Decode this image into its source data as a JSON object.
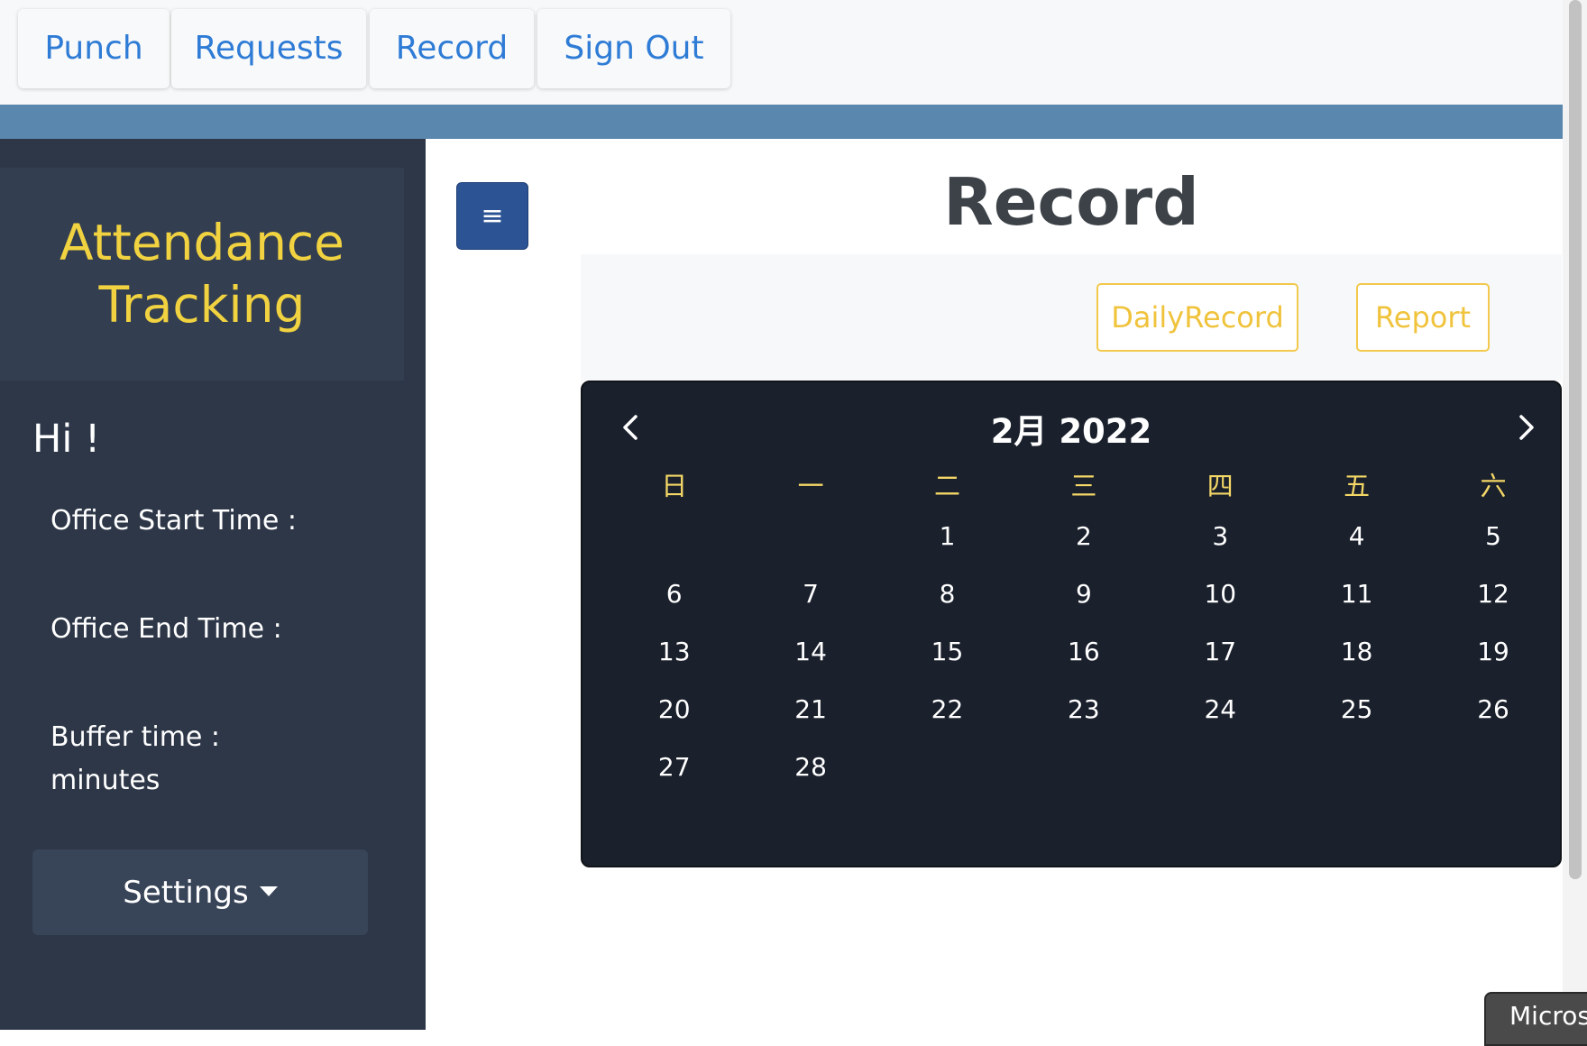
{
  "topnav": {
    "items": [
      {
        "label": "Punch"
      },
      {
        "label": "Requests"
      },
      {
        "label": "Record"
      },
      {
        "label": "Sign Out"
      }
    ]
  },
  "sidebar": {
    "brand": "Attendance Tracking",
    "greeting": "Hi !",
    "office_start_label": "Office Start Time :",
    "office_end_label": "Office End Time :",
    "buffer_label": "Buffer time :",
    "buffer_unit": "minutes",
    "settings_label": "Settings"
  },
  "main": {
    "toggle_icon": "≡",
    "title": "Record",
    "buttons": {
      "daily_record": "DailyRecord",
      "report": "Report"
    }
  },
  "calendar": {
    "title": "2月 2022",
    "weekdays": [
      "日",
      "一",
      "二",
      "三",
      "四",
      "五",
      "六"
    ],
    "weeks": [
      [
        "",
        "",
        "1",
        "2",
        "3",
        "4",
        "5"
      ],
      [
        "6",
        "7",
        "8",
        "9",
        "10",
        "11",
        "12"
      ],
      [
        "13",
        "14",
        "15",
        "16",
        "17",
        "18",
        "19"
      ],
      [
        "20",
        "21",
        "22",
        "23",
        "24",
        "25",
        "26"
      ],
      [
        "27",
        "28",
        "",
        "",
        "",
        "",
        ""
      ]
    ]
  },
  "edge_tab": {
    "label": "Micros"
  },
  "colors": {
    "accent_blue": "#2f7cd6",
    "brand_yellow": "#f1d240",
    "sidebar_bg": "#2d3748",
    "calendar_bg": "#1a202c",
    "outline_yellow": "#f2c94c"
  }
}
